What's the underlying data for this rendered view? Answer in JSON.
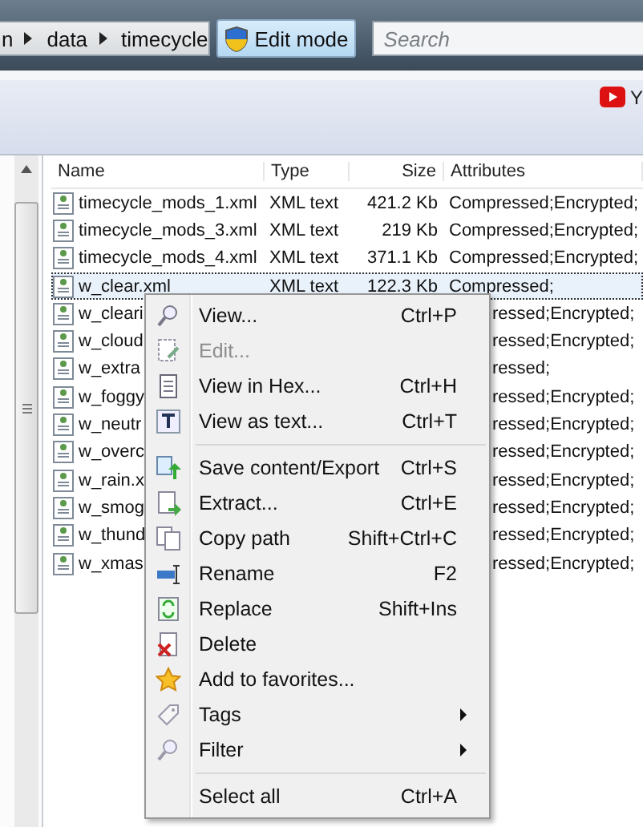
{
  "breadcrumb": {
    "items": [
      "n",
      "data",
      "timecycle"
    ]
  },
  "edit_mode_button": {
    "label": "Edit mode",
    "selected": true
  },
  "search": {
    "placeholder": "Search"
  },
  "toolbar": {
    "label": "Y"
  },
  "table": {
    "columns": [
      "Name",
      "Type",
      "Size",
      "Attributes"
    ],
    "rows": [
      {
        "name": "timecycle_mods_1.xml",
        "type": "XML text",
        "size": "421.2 Kb",
        "attributes": "Compressed;Encrypted;",
        "selected": false
      },
      {
        "name": "timecycle_mods_3.xml",
        "type": "XML text",
        "size": "219 Kb",
        "attributes": "Compressed;Encrypted;",
        "selected": false
      },
      {
        "name": "timecycle_mods_4.xml",
        "type": "XML text",
        "size": "371.1 Kb",
        "attributes": "Compressed;Encrypted;",
        "selected": false
      },
      {
        "name": "w_clear.xml",
        "type": "XML text",
        "size": "122.3 Kb",
        "attributes": "Compressed;",
        "selected": true
      },
      {
        "name": "w_cleari",
        "attributes": "ressed;Encrypted;",
        "selected": false
      },
      {
        "name": "w_cloud",
        "attributes": "ressed;Encrypted;",
        "selected": false
      },
      {
        "name": "w_extra",
        "attributes": "ressed;",
        "selected": false
      },
      {
        "name": "w_foggy",
        "attributes": "ressed;Encrypted;",
        "selected": false
      },
      {
        "name": "w_neutr",
        "attributes": "ressed;Encrypted;",
        "selected": false
      },
      {
        "name": "w_overc",
        "attributes": "ressed;Encrypted;",
        "selected": false
      },
      {
        "name": "w_rain.x",
        "attributes": "ressed;Encrypted;",
        "selected": false
      },
      {
        "name": "w_smog",
        "attributes": "ressed;Encrypted;",
        "selected": false
      },
      {
        "name": "w_thund",
        "attributes": "ressed;Encrypted;",
        "selected": false
      },
      {
        "name": "w_xmas",
        "attributes": "ressed;Encrypted;",
        "selected": false
      }
    ]
  },
  "context_menu": {
    "items": [
      {
        "kind": "item",
        "label": "View...",
        "shortcut": "Ctrl+P",
        "disabled": false
      },
      {
        "kind": "item",
        "label": "Edit...",
        "disabled": true
      },
      {
        "kind": "item",
        "label": "View in Hex...",
        "shortcut": "Ctrl+H",
        "disabled": false
      },
      {
        "kind": "item",
        "label": "View as text...",
        "shortcut": "Ctrl+T",
        "disabled": false
      },
      {
        "kind": "separator"
      },
      {
        "kind": "item",
        "label": "Save content/Export",
        "shortcut": "Ctrl+S",
        "disabled": false
      },
      {
        "kind": "item",
        "label": "Extract...",
        "shortcut": "Ctrl+E",
        "disabled": false
      },
      {
        "kind": "item",
        "label": "Copy path",
        "shortcut": "Shift+Ctrl+C",
        "disabled": false
      },
      {
        "kind": "item",
        "label": "Rename",
        "shortcut": "F2",
        "disabled": false
      },
      {
        "kind": "item",
        "label": "Replace",
        "shortcut": "Shift+Ins",
        "disabled": false
      },
      {
        "kind": "item",
        "label": "Delete",
        "disabled": false
      },
      {
        "kind": "item",
        "label": "Add to favorites...",
        "disabled": false
      },
      {
        "kind": "item",
        "label": "Tags",
        "submenu": true,
        "disabled": false
      },
      {
        "kind": "item",
        "label": "Filter",
        "submenu": true,
        "disabled": false
      },
      {
        "kind": "separator"
      },
      {
        "kind": "item",
        "label": "Select all",
        "shortcut": "Ctrl+A",
        "disabled": false
      }
    ]
  }
}
